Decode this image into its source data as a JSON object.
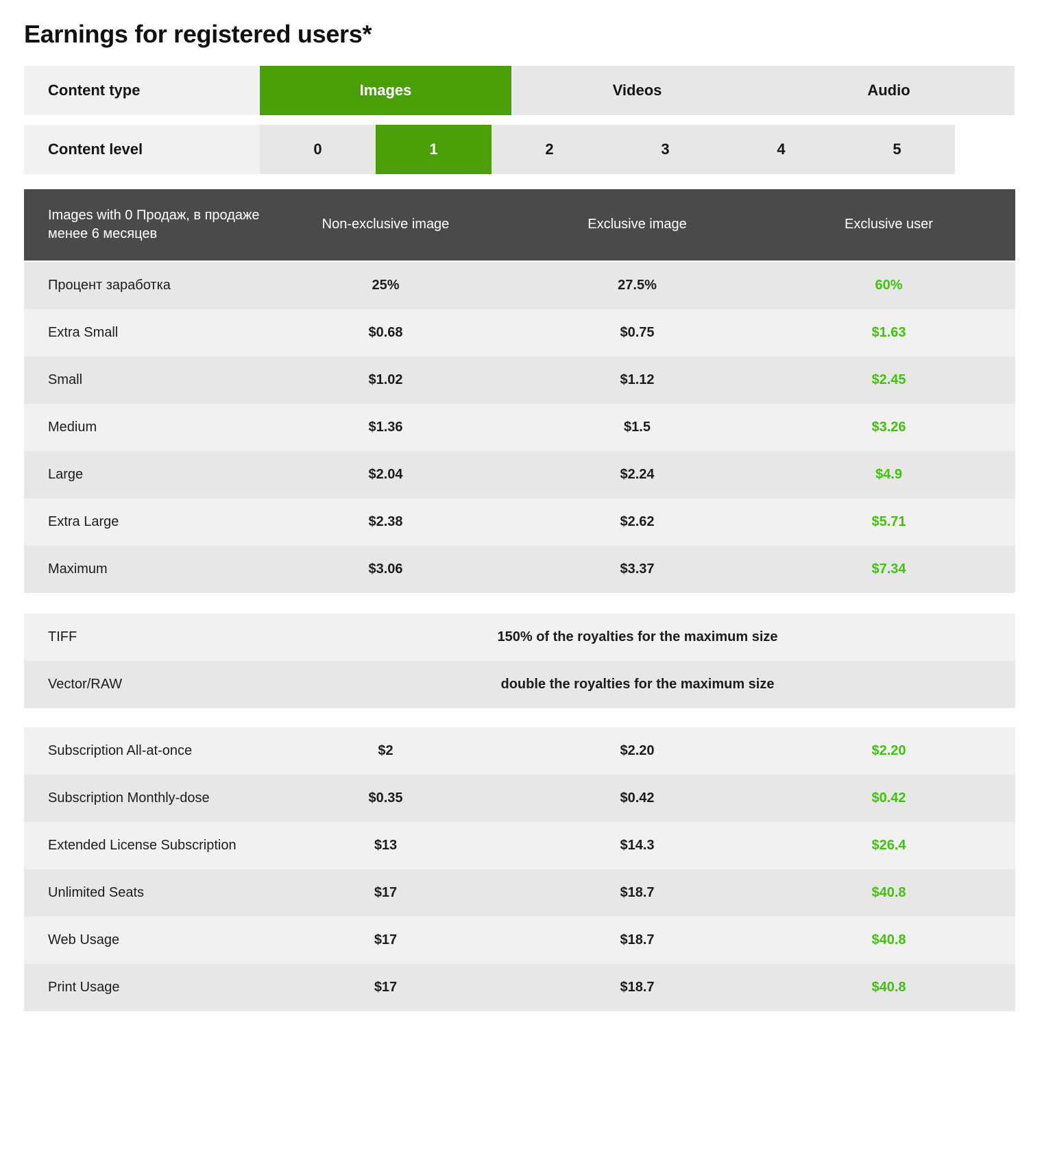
{
  "title": "Earnings for registered users*",
  "selectors": {
    "content_type": {
      "label": "Content type",
      "options": [
        "Images",
        "Videos",
        "Audio"
      ],
      "selected": "Images"
    },
    "content_level": {
      "label": "Content level",
      "options": [
        "0",
        "1",
        "2",
        "3",
        "4",
        "5"
      ],
      "selected": "1"
    }
  },
  "accent_green": "#4a9e06",
  "value_green": "#3fc40b",
  "dark_header_bg": "#4a4a4a",
  "table": {
    "header": {
      "label": "Images with 0 Продаж, в продаже менее 6 месяцев",
      "columns": [
        "Non-exclusive image",
        "Exclusive image",
        "Exclusive user"
      ]
    },
    "rows": [
      {
        "label": "Процент заработка",
        "values": [
          "25%",
          "27.5%",
          "60%"
        ]
      },
      {
        "label": "Extra Small",
        "values": [
          "$0.68",
          "$0.75",
          "$1.63"
        ]
      },
      {
        "label": "Small",
        "values": [
          "$1.02",
          "$1.12",
          "$2.45"
        ]
      },
      {
        "label": "Medium",
        "values": [
          "$1.36",
          "$1.5",
          "$3.26"
        ]
      },
      {
        "label": "Large",
        "values": [
          "$2.04",
          "$2.24",
          "$4.9"
        ]
      },
      {
        "label": "Extra Large",
        "values": [
          "$2.38",
          "$2.62",
          "$5.71"
        ]
      },
      {
        "label": "Maximum",
        "values": [
          "$3.06",
          "$3.37",
          "$7.34"
        ]
      }
    ],
    "notes": [
      {
        "label": "TIFF",
        "text": "150% of the royalties for the maximum size"
      },
      {
        "label": "Vector/RAW",
        "text": "double the royalties for the maximum size"
      }
    ],
    "subscription_rows": [
      {
        "label": "Subscription All-at-once",
        "values": [
          "$2",
          "$2.20",
          "$2.20"
        ]
      },
      {
        "label": "Subscription Monthly-dose",
        "values": [
          "$0.35",
          "$0.42",
          "$0.42"
        ]
      },
      {
        "label": "Extended License Subscription",
        "values": [
          "$13",
          "$14.3",
          "$26.4"
        ]
      },
      {
        "label": "Unlimited Seats",
        "values": [
          "$17",
          "$18.7",
          "$40.8"
        ]
      },
      {
        "label": "Web Usage",
        "values": [
          "$17",
          "$18.7",
          "$40.8"
        ]
      },
      {
        "label": "Print Usage",
        "values": [
          "$17",
          "$18.7",
          "$40.8"
        ]
      }
    ]
  }
}
